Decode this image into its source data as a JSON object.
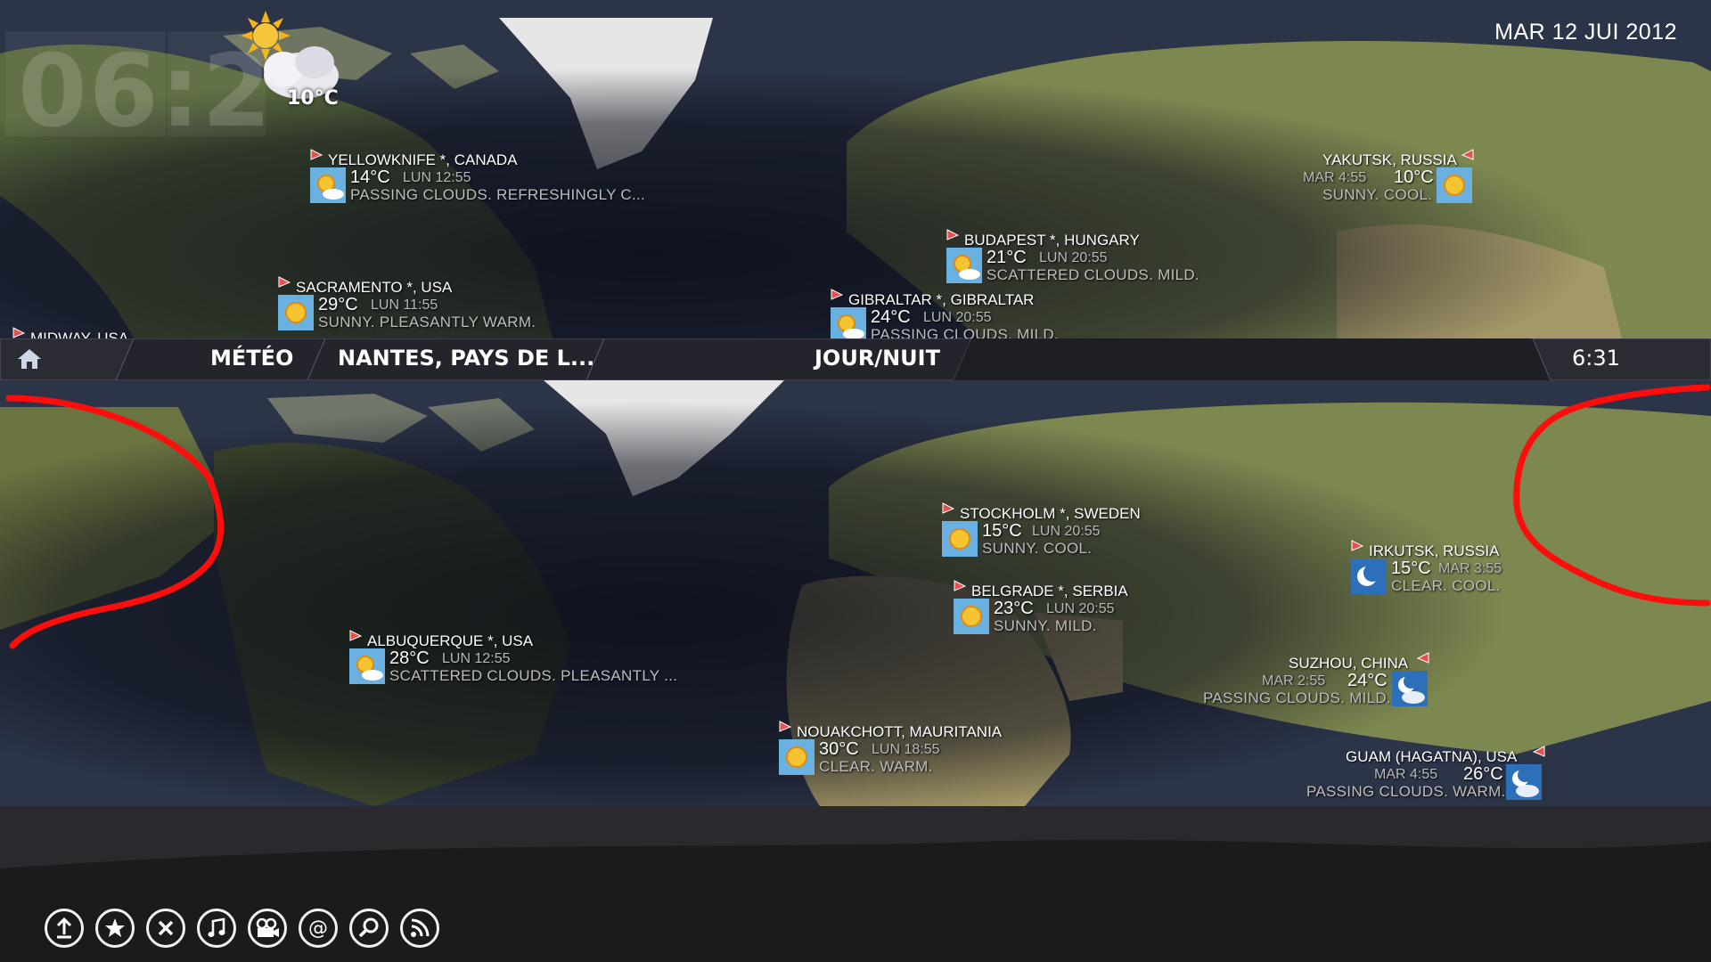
{
  "header": {
    "clock": "06:2",
    "current_temp": "10°C",
    "date": "MAR 12 JUI 2012"
  },
  "top_map_cities": [
    {
      "name": "YELLOWKNIFE *, CANADA",
      "temp": "14°C",
      "time": "LUN 12:55",
      "cond": "PASSING CLOUDS. REFRESHINGLY C...",
      "icon": "sun-cloud-icon"
    },
    {
      "name": "SACRAMENTO *, USA",
      "temp": "29°C",
      "time": "LUN 11:55",
      "cond": "SUNNY. PLEASANTLY WARM.",
      "icon": "sun-icon"
    },
    {
      "name": "MIDWAY, USA",
      "temp": "",
      "time": "",
      "cond": "",
      "icon": ""
    },
    {
      "name": "BUDAPEST *, HUNGARY",
      "temp": "21°C",
      "time": "LUN 20:55",
      "cond": "SCATTERED CLOUDS. MILD.",
      "icon": "sun-cloud-icon"
    },
    {
      "name": "GIBRALTAR *, GIBRALTAR",
      "temp": "24°C",
      "time": "LUN 20:55",
      "cond": "PASSING CLOUDS. MILD.",
      "icon": "sun-cloud-icon"
    },
    {
      "name": "YAKUTSK, RUSSIA",
      "temp": "10°C",
      "time": "MAR 4:55",
      "cond": "SUNNY. COOL.",
      "icon": "sun-icon"
    }
  ],
  "menubar": {
    "home_icon": "home-icon",
    "tab1": "MÉTÉO",
    "tab2": "NANTES, PAYS DE L...",
    "tab3": "JOUR/NUIT",
    "time": "6:31"
  },
  "bottom_map_cities": [
    {
      "name": "STOCKHOLM *, SWEDEN",
      "temp": "15°C",
      "time": "LUN 20:55",
      "cond": "SUNNY. COOL.",
      "icon": "sun-icon"
    },
    {
      "name": "BELGRADE *, SERBIA",
      "temp": "23°C",
      "time": "LUN 20:55",
      "cond": "SUNNY. MILD.",
      "icon": "sun-icon"
    },
    {
      "name": "IRKUTSK, RUSSIA",
      "temp": "15°C",
      "time": "MAR 3:55",
      "cond": "CLEAR. COOL.",
      "icon": "moon-icon"
    },
    {
      "name": "ALBUQUERQUE *, USA",
      "temp": "28°C",
      "time": "LUN 12:55",
      "cond": "SCATTERED CLOUDS. PLEASANTLY ...",
      "icon": "sun-cloud-icon"
    },
    {
      "name": "SUZHOU, CHINA",
      "temp": "24°C",
      "time": "MAR 2:55",
      "cond": "PASSING CLOUDS. MILD.",
      "icon": "moon-cloud-icon"
    },
    {
      "name": "NOUAKCHOTT, MAURITANIA",
      "temp": "30°C",
      "time": "LUN 18:55",
      "cond": "CLEAR. WARM.",
      "icon": "sun-icon"
    },
    {
      "name": "GUAM (HAGATNA), USA",
      "temp": "26°C",
      "time": "MAR 4:55",
      "cond": "PASSING CLOUDS. WARM.",
      "icon": "moon-cloud-icon"
    }
  ],
  "bottom_buttons": [
    "upload-icon",
    "star-icon",
    "close-icon",
    "music-icon",
    "video-icon",
    "at-icon",
    "search-icon",
    "rss-icon"
  ]
}
